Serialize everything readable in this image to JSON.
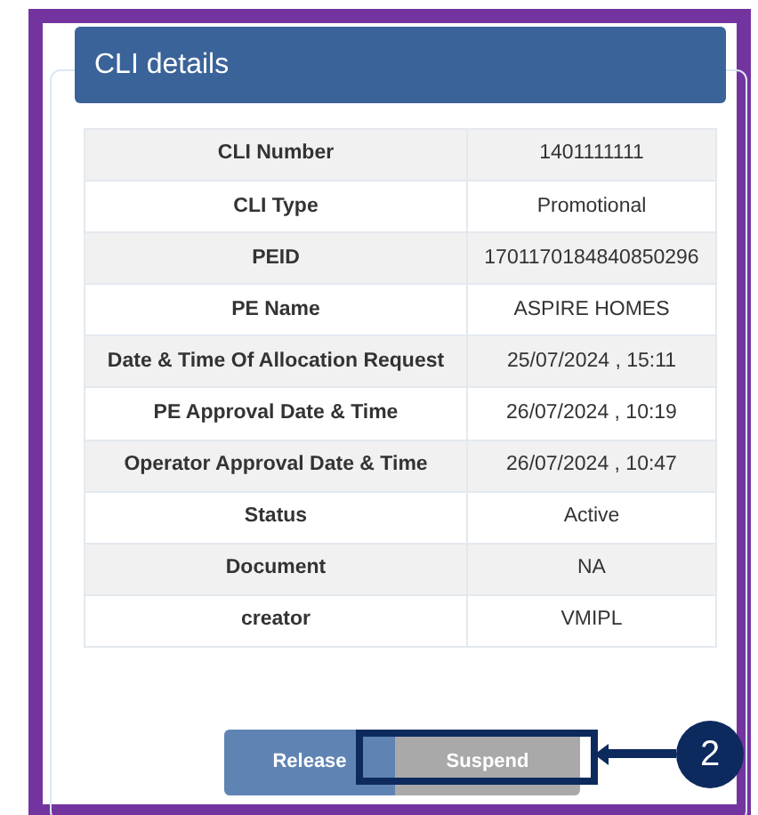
{
  "panel": {
    "title": "CLI details"
  },
  "details": [
    {
      "label": "CLI Number",
      "value": "1401111111"
    },
    {
      "label": "CLI Type",
      "value": "Promotional"
    },
    {
      "label": "PEID",
      "value": "1701170184840850296"
    },
    {
      "label": "PE Name",
      "value": "ASPIRE HOMES"
    },
    {
      "label": "Date & Time Of Allocation Request",
      "value": "25/07/2024 , 15:11"
    },
    {
      "label": "PE Approval Date & Time",
      "value": "26/07/2024 , 10:19"
    },
    {
      "label": "Operator Approval Date & Time",
      "value": "26/07/2024 , 10:47"
    },
    {
      "label": "Status",
      "value": "Active"
    },
    {
      "label": "Document",
      "value": "NA"
    },
    {
      "label": "creator",
      "value": "VMIPL"
    }
  ],
  "buttons": [
    {
      "label": "Release",
      "kind": "primary"
    },
    {
      "label": "Suspend",
      "kind": "secondary"
    }
  ],
  "callout": {
    "number": "2"
  }
}
